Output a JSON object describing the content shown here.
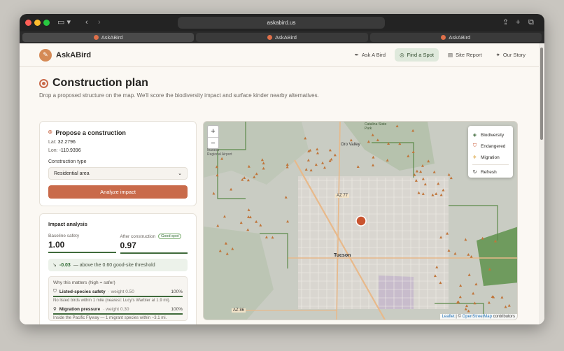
{
  "browser": {
    "url": "askabird.us",
    "tabs": [
      {
        "label": "AskABird"
      },
      {
        "label": "AskABird"
      },
      {
        "label": "AskABird"
      }
    ]
  },
  "nav": {
    "brand": "AskABird",
    "links": [
      {
        "label": "Ask A Bird",
        "icon": "feather-icon"
      },
      {
        "label": "Find a Spot",
        "icon": "target-icon"
      },
      {
        "label": "Site Report",
        "icon": "document-icon"
      },
      {
        "label": "Our Story",
        "icon": "sparkle-icon"
      }
    ]
  },
  "hero": {
    "title": "Construction plan",
    "subtitle": "Drop a proposed structure on the map. We'll score the biodiversity impact and surface kinder nearby alternatives."
  },
  "propose": {
    "title": "Propose a construction",
    "lat_label": "Lat:",
    "lat": "32.2796",
    "lon_label": "Lon:",
    "lon": "-110.9396",
    "type_label": "Construction type",
    "type_value": "Residential area",
    "analyze_label": "Analyze impact"
  },
  "impact": {
    "title": "Impact analysis",
    "baseline_label": "Baseline safety",
    "baseline_value": "1.00",
    "after_label": "After construction",
    "after_badge": "Good spot",
    "after_value": "0.97",
    "delta_value": "-0.03",
    "delta_text": "— above the 0.60 good-site threshold",
    "why_title": "Why this matters (high = safer)",
    "factors": [
      {
        "name": "Listed-species safety",
        "weight": "· weight 0.50",
        "pct": "100%",
        "desc": "No listed birds within 1 mile (nearest: Lucy's Warbler at 1.9 mi)."
      },
      {
        "name": "Migration pressure",
        "weight": "· weight 0.30",
        "pct": "100%",
        "desc": "Inside the Pacific Flyway — 1 migrant species within ~3.1 mi."
      }
    ]
  },
  "map": {
    "layers": [
      {
        "label": "Biodiversity",
        "icon": "layers-icon"
      },
      {
        "label": "Endangered",
        "icon": "shield-icon"
      },
      {
        "label": "Migration",
        "icon": "bird-icon"
      }
    ],
    "refresh_label": "Refresh",
    "zoom_in": "+",
    "zoom_out": "−",
    "labels": {
      "tucson": "Tucson",
      "oro_valley": "Oro Valley",
      "az77": "AZ 77",
      "az86": "AZ 86",
      "catalina": "Catalina State Park",
      "airport": "Marana Regional Airport"
    },
    "attribution_leaflet": "Leaflet",
    "attribution_sep": "| ©",
    "attribution_osm": "OpenStreetMap",
    "attribution_tail": "contributors",
    "colors": {
      "marker": "#c9542f",
      "forest": "#5c8a4a",
      "road": "#e8b98a"
    }
  }
}
